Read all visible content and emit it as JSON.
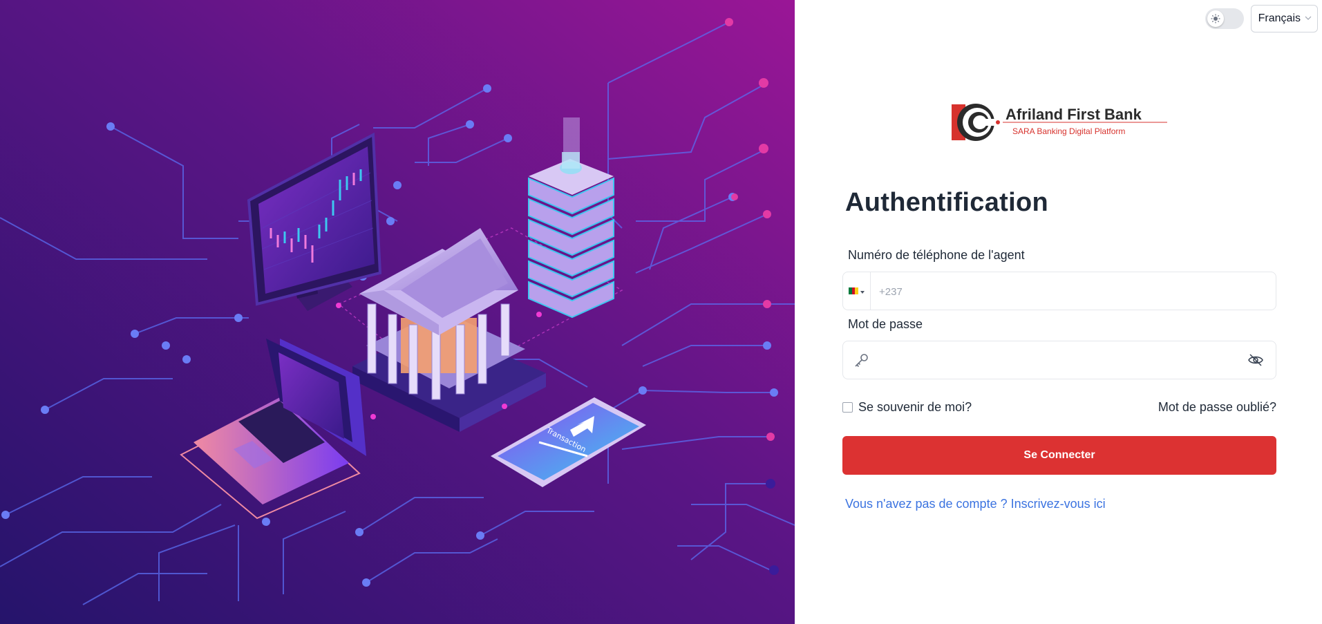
{
  "topbar": {
    "theme_toggle": "light",
    "language": "Français"
  },
  "brand": {
    "name": "Afriland First Bank",
    "tagline": "SARA Banking Digital Platform"
  },
  "form": {
    "title": "Authentification",
    "phone_label": "Numéro de téléphone de l'agent",
    "phone_placeholder": "+237",
    "phone_value": "",
    "password_label": "Mot de passe",
    "password_value": "",
    "remember_label": "Se souvenir de moi?",
    "remember_checked": false,
    "forgot_label": "Mot de passe oublié?",
    "submit_label": "Se Connecter",
    "signup_label": "Vous n'avez pas de compte ? Inscrivez-vous ici"
  },
  "hero": {
    "phone_screen_text": "Transaction"
  },
  "icons": {
    "theme": "sun-icon",
    "language": "chevron-down-icon",
    "flag": "cameroon-flag-icon",
    "password": "key-icon",
    "visibility": "eye-off-icon"
  },
  "colors": {
    "primary": "#dc3232",
    "link": "#3b73e0",
    "hero_start": "#2a1670",
    "hero_end": "#9a1696",
    "brand_red": "#d7322d",
    "brand_dark": "#2b2b2b",
    "flag_green": "#007a3d",
    "flag_red": "#ce1126",
    "flag_yellow": "#fcd116"
  }
}
